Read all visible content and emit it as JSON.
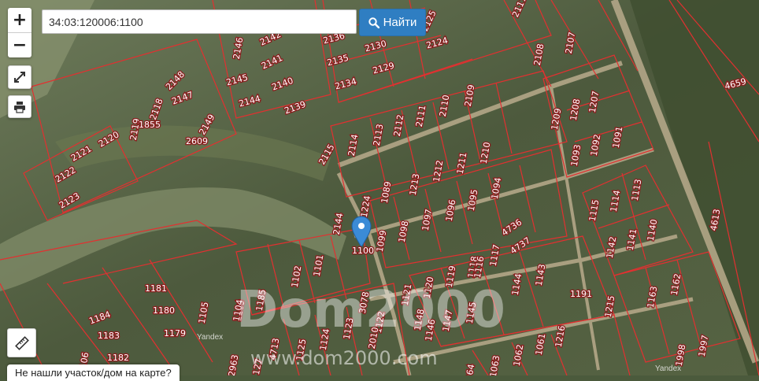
{
  "search": {
    "value": "34:03:120006:1100"
  },
  "find_button": {
    "label": "Найти"
  },
  "zoom": {
    "in": "+",
    "out": "−"
  },
  "tools": {
    "fullscreen_icon": "expand-icon",
    "print_icon": "printer-icon",
    "ruler_icon": "ruler-icon"
  },
  "bottom_tip": {
    "text": "Не нашли участок/дом на карте?"
  },
  "watermark": {
    "brand": "Dom2000",
    "site": "www.dom2000.com"
  },
  "attribution": {
    "left": "Yandex",
    "right": "Yandex"
  },
  "marker": {
    "label": "1100"
  },
  "colors": {
    "boundary": "#e23030",
    "button": "#2f7ec2",
    "marker": "#3b8bd6"
  },
  "parcels": [
    "2146",
    "2142",
    "2136",
    "2130",
    "2125",
    "2117",
    "2107",
    "2141",
    "2135",
    "2129",
    "2124",
    "2108",
    "2145",
    "2140",
    "2134",
    "4659",
    "2148",
    "2118",
    "2147",
    "2144",
    "2139",
    "2109",
    "2110",
    "2111",
    "2112",
    "2113",
    "2114",
    "1207",
    "1208",
    "1209",
    "2119",
    "1855",
    "2149",
    "1091",
    "1092",
    "1093",
    "2120",
    "2121",
    "2609",
    "2115",
    "1210",
    "1211",
    "1212",
    "1213",
    "1089",
    "1094",
    "1095",
    "1096",
    "1097",
    "1098",
    "1099",
    "1113",
    "1114",
    "1115",
    "2122",
    "2123",
    "1224",
    "2144",
    "4613",
    "1140",
    "1141",
    "1142",
    "4736",
    "4737",
    "1117",
    "1118",
    "1119",
    "1120",
    "1121",
    "1101",
    "1102",
    "1103",
    "1143",
    "1144",
    "1145",
    "1146",
    "1147",
    "1181",
    "1180",
    "1105",
    "1184",
    "1104",
    "1185",
    "1183",
    "1179",
    "1182",
    "1125",
    "4713",
    "1124",
    "1123",
    "1122",
    "2010",
    "3078",
    "1191",
    "1215",
    "1216",
    "1061",
    "1062",
    "1063",
    "1064",
    "1106",
    "2963",
    "1127",
    "1163",
    "1162",
    "1998",
    "1997",
    "1148",
    "1116"
  ]
}
